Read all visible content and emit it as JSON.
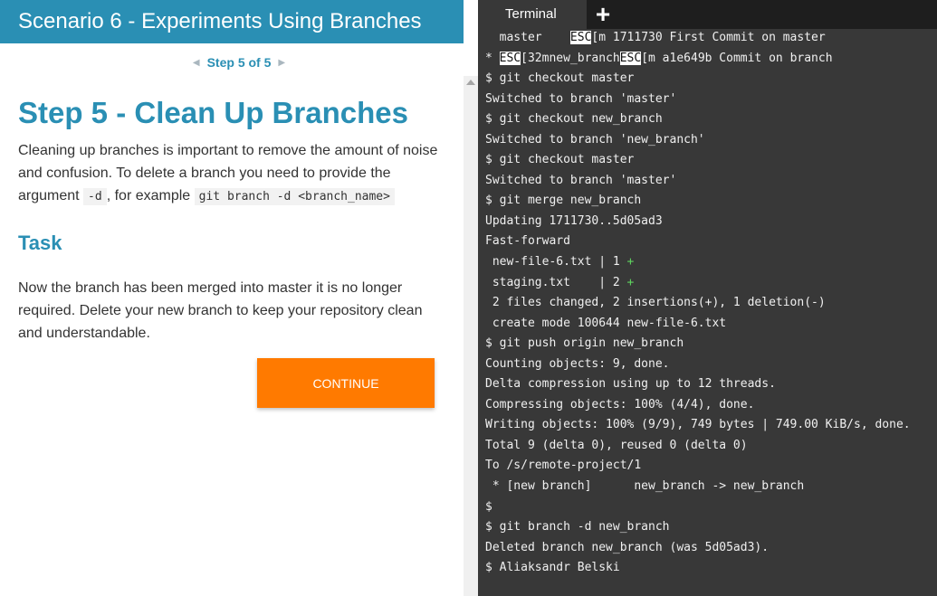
{
  "scenario": {
    "title": "Scenario 6 - Experiments Using Branches",
    "step_indicator": "Step 5 of 5"
  },
  "step": {
    "title": "Step 5 - Clean Up Branches",
    "paragraph_1": "Cleaning up branches is important to remove the amount of noise and confusion. To delete a branch you need to provide the argument ",
    "flag": "-d",
    "paragraph_mid": ", for example ",
    "example": "git branch -d <branch_name>",
    "task_heading": "Task",
    "task_text": "Now the branch has been merged into master it is no longer required. Delete your new branch to keep your repository clean and understandable.",
    "continue_label": "CONTINUE"
  },
  "terminal": {
    "tab_label": "Terminal",
    "add_tab_label": "+",
    "lines": [
      [
        {
          "t": "  master    "
        },
        {
          "t": "ESC",
          "esc": true
        },
        {
          "t": "[m 1711730 First Commit on master"
        }
      ],
      [
        {
          "t": "* "
        },
        {
          "t": "ESC",
          "esc": true
        },
        {
          "t": "[32mnew_branch"
        },
        {
          "t": "ESC",
          "esc": true
        },
        {
          "t": "[m a1e649b Commit on branch"
        }
      ],
      [
        {
          "t": "$ git checkout master"
        }
      ],
      [
        {
          "t": "Switched to branch 'master'"
        }
      ],
      [
        {
          "t": "$ git checkout new_branch"
        }
      ],
      [
        {
          "t": "Switched to branch 'new_branch'"
        }
      ],
      [
        {
          "t": "$ git checkout master"
        }
      ],
      [
        {
          "t": "Switched to branch 'master'"
        }
      ],
      [
        {
          "t": "$ git merge new_branch"
        }
      ],
      [
        {
          "t": "Updating 1711730..5d05ad3"
        }
      ],
      [
        {
          "t": "Fast-forward"
        }
      ],
      [
        {
          "t": " new-file-6.txt | 1 "
        },
        {
          "t": "+",
          "plus": true
        }
      ],
      [
        {
          "t": " staging.txt    | 2 "
        },
        {
          "t": "+",
          "plus": true
        }
      ],
      [
        {
          "t": " 2 files changed, 2 insertions(+), 1 deletion(-)"
        }
      ],
      [
        {
          "t": " create mode 100644 new-file-6.txt"
        }
      ],
      [
        {
          "t": "$ git push origin new_branch"
        }
      ],
      [
        {
          "t": "Counting objects: 9, done."
        }
      ],
      [
        {
          "t": "Delta compression using up to 12 threads."
        }
      ],
      [
        {
          "t": "Compressing objects: 100% (4/4), done."
        }
      ],
      [
        {
          "t": "Writing objects: 100% (9/9), 749 bytes | 749.00 KiB/s, done."
        }
      ],
      [
        {
          "t": "Total 9 (delta 0), reused 0 (delta 0)"
        }
      ],
      [
        {
          "t": "To /s/remote-project/1"
        }
      ],
      [
        {
          "t": " * [new branch]      new_branch -> new_branch"
        }
      ],
      [
        {
          "t": "$"
        }
      ],
      [
        {
          "t": "$ git branch -d new_branch"
        }
      ],
      [
        {
          "t": "Deleted branch new_branch (was 5d05ad3)."
        }
      ],
      [
        {
          "t": "$ Aliaksandr Belski"
        }
      ]
    ]
  },
  "colors": {
    "accent": "#2a8fb4",
    "button": "#ff7a00",
    "terminal_bg": "#383838",
    "tabbar_bg": "#1e1e1e",
    "diff_plus": "#5fd35f"
  }
}
